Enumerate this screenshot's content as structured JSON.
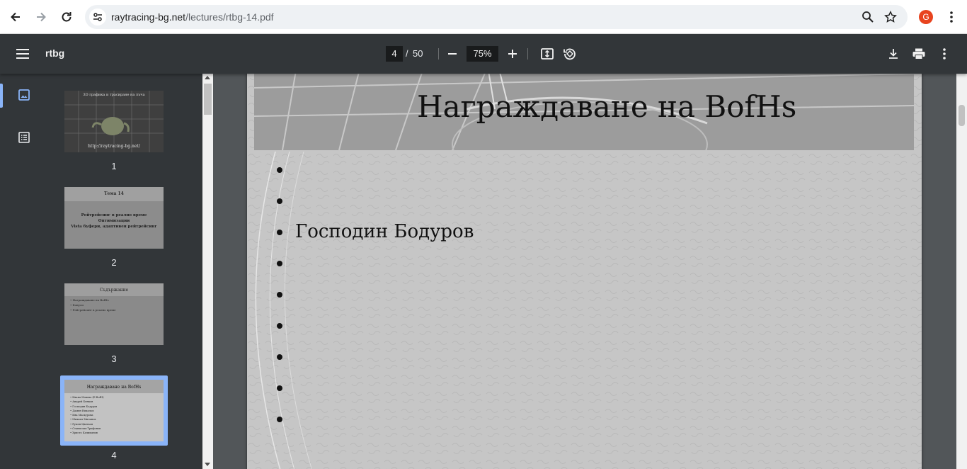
{
  "browser": {
    "url_domain": "raytracing-bg.net",
    "url_path": "/lectures/rtbg-14.pdf",
    "profile_initial": "G",
    "icons": [
      "back-arrow-icon",
      "forward-arrow-icon",
      "reload-icon",
      "site-settings-icon",
      "zoom-icon",
      "star-icon",
      "kebab-menu-icon"
    ]
  },
  "pdf_toolbar": {
    "title": "rtbg",
    "current_page": "4",
    "separator": "/",
    "total_pages": "50",
    "zoom": "75%",
    "icons": [
      "menu-icon",
      "zoom-out-icon",
      "zoom-in-icon",
      "fit-page-icon",
      "rotate-icon",
      "download-icon",
      "print-icon",
      "more-icon"
    ]
  },
  "sidebar": {
    "tabs": [
      {
        "name": "thumbnails",
        "icon": "image-icon",
        "active": true
      },
      {
        "name": "outline",
        "icon": "outline-list-icon",
        "active": false
      }
    ],
    "thumbnails": [
      {
        "label": "1",
        "header": "3D графика и трасиране на лъча",
        "footer": "http://raytracing-bg.net/"
      },
      {
        "label": "2",
        "header": "Тема 14",
        "lines": [
          "Рейтрейсинг в реално време",
          "Оптимизации",
          "Vista буфери, адаптивен рейтрейсинг"
        ]
      },
      {
        "label": "3",
        "header": "Съдържание",
        "lines": [
          "Награждаване на BofHs",
          "Бонуси",
          "Рейтрейсинг в реално време"
        ]
      },
      {
        "label": "4",
        "header": "Награждаване на BofHs",
        "lines": [
          "Ивана Илиева (E-BofH)",
          "Андрей Бянков",
          "Господин Бодуров",
          "Дамян Николов",
          "Ива Маскурова",
          "Михаил Миланов",
          "Румен Цвятков",
          "Станислав Трифонов",
          "Христо Калиманов"
        ],
        "selected": true
      }
    ]
  },
  "slide": {
    "title": "Награждаване на BofHs",
    "bullets": [
      "",
      "",
      "Господин Бодуров",
      "",
      "",
      "",
      "",
      "",
      ""
    ]
  },
  "colors": {
    "toolbar_bg": "#323639",
    "viewer_bg": "#525659",
    "accent": "#8ab4f8",
    "avatar": "#e8441f"
  }
}
